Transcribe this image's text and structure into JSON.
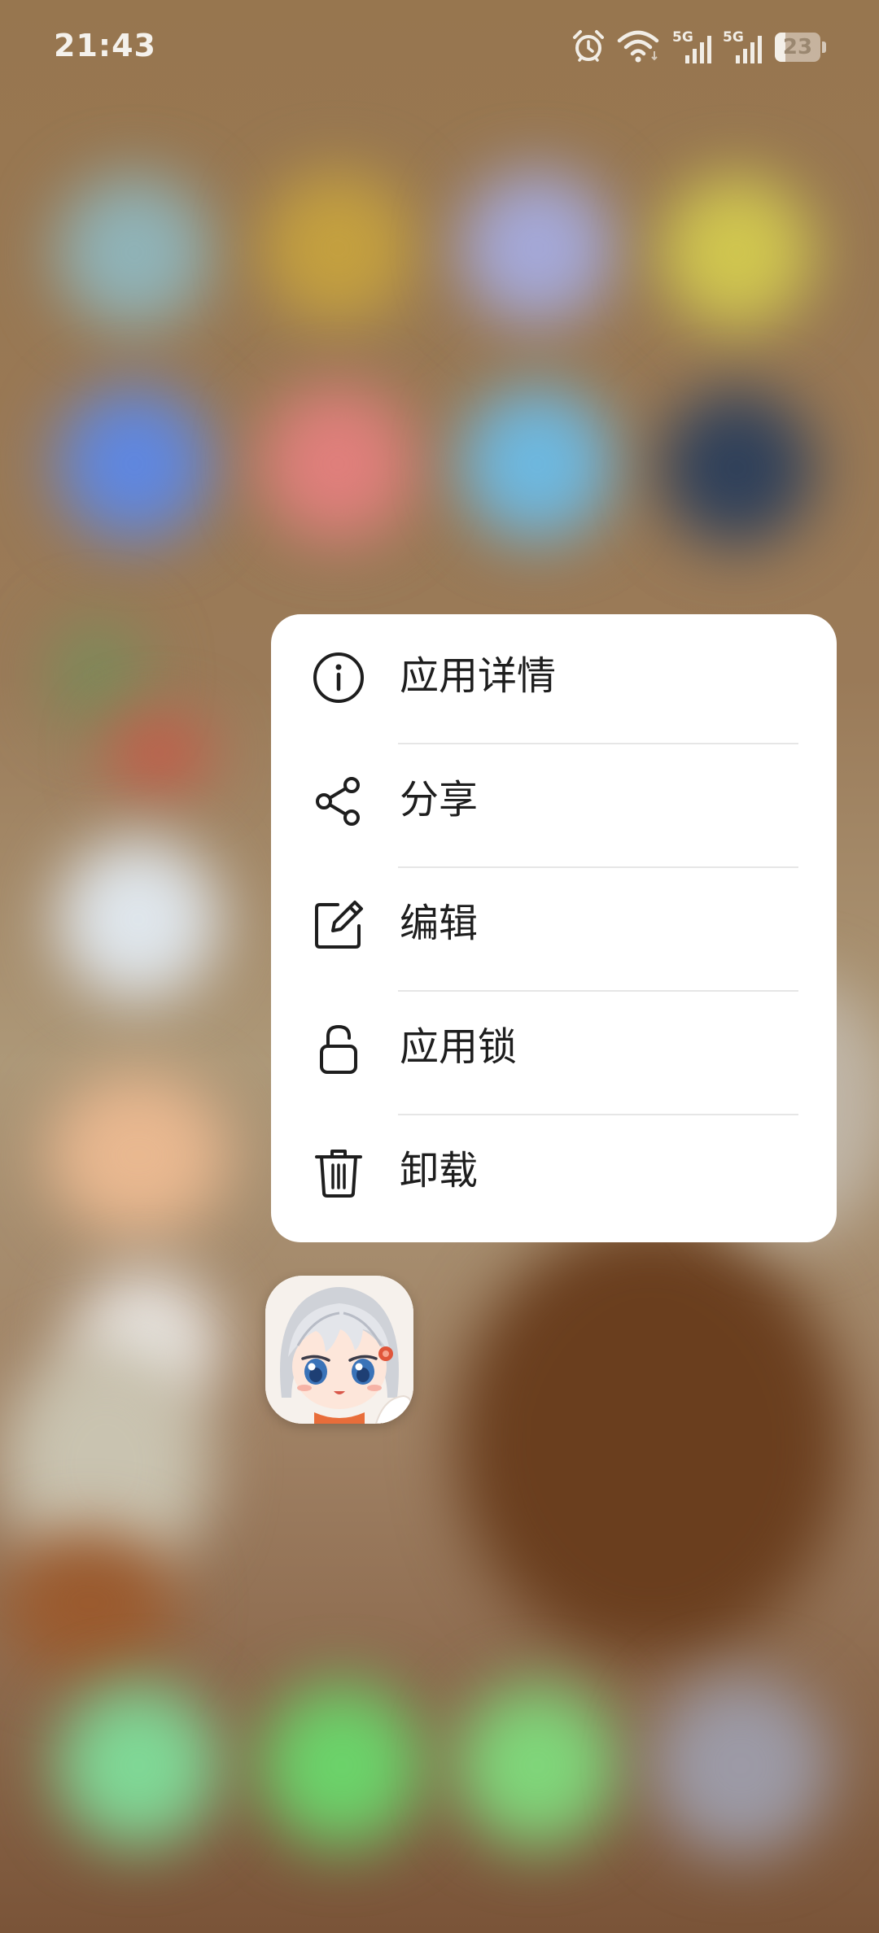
{
  "status_bar": {
    "time": "21:43",
    "icons": [
      "alarm-icon",
      "wifi-icon",
      "signal-5g-icon",
      "signal-5g-icon"
    ],
    "signal_label_1": "5G",
    "signal_label_2": "5G",
    "battery_level": "23",
    "battery_fraction": 0.23
  },
  "context_menu": {
    "items": [
      {
        "label": "应用详情",
        "icon": "info-icon"
      },
      {
        "label": "分享",
        "icon": "share-icon"
      },
      {
        "label": "编辑",
        "icon": "edit-icon"
      },
      {
        "label": "应用锁",
        "icon": "lock-icon"
      },
      {
        "label": "卸载",
        "icon": "trash-icon"
      }
    ]
  },
  "app": {
    "icon": "anime-character-app-icon"
  },
  "colors": {
    "menu_background": "#ffffff",
    "menu_text": "#1e1e1e",
    "divider": "#e6e6e6",
    "wallpaper": "#8f7150"
  }
}
